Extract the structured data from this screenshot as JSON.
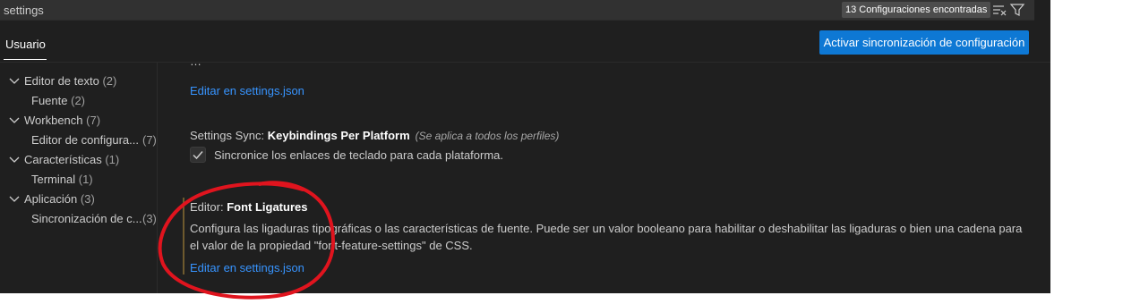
{
  "search": {
    "value": "settings",
    "results_count": "13 Configuraciones encontradas"
  },
  "scope_tabs": [
    {
      "label": "Usuario"
    }
  ],
  "sync_button_label": "Activar sincronización de configuración",
  "toc": [
    {
      "label": "Editor de texto",
      "count": "(2)",
      "expanded": true
    },
    {
      "label": "Fuente",
      "count": "(2)"
    },
    {
      "label": "Workbench",
      "count": "(7)",
      "expanded": true
    },
    {
      "label": "Editor de configura...",
      "count": "(7)"
    },
    {
      "label": "Características",
      "count": "(1)",
      "expanded": true
    },
    {
      "label": "Terminal",
      "count": "(1)"
    },
    {
      "label": "Aplicación",
      "count": "(3)",
      "expanded": true
    },
    {
      "label": "Sincronización de c...",
      "count": "(3)"
    }
  ],
  "settings": [
    {
      "partial_title": "…",
      "edit_link": "Editar en settings.json"
    },
    {
      "category": "Settings Sync: ",
      "name": "Keybindings Per Platform",
      "scope_note": "(Se aplica a todos los perfiles)",
      "checkbox_checked": true,
      "checkbox_label": "Sincronice los enlaces de teclado para cada plataforma."
    },
    {
      "category": "Editor: ",
      "name": "Font Ligatures",
      "description": "Configura las ligaduras tipográficas o las características de fuente. Puede ser un valor booleano para habilitar o deshabilitar las ligaduras o bien una cadena para el valor de la propiedad \"font-feature-settings\" de CSS.",
      "edit_link": "Editar en settings.json",
      "modified": true
    }
  ],
  "colors": {
    "background": "#1f1f1f",
    "accent_button": "#0e78d4",
    "link": "#3794ff",
    "annotation": "#e0141e",
    "modified_indicator": "#6e5a2e"
  }
}
